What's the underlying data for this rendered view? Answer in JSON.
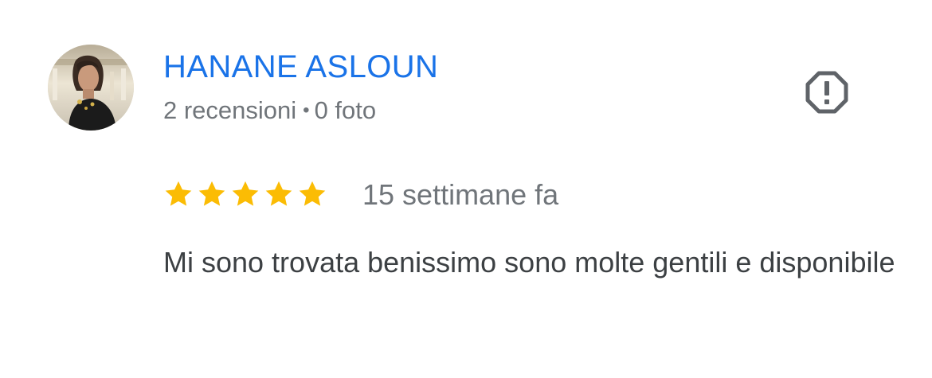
{
  "review": {
    "author": {
      "name": "HANANE ASLOUN",
      "reviews_count": "2 recensioni",
      "separator": "•",
      "photos_count": "0 foto",
      "avatar": "avatar-photo"
    },
    "report_icon": "report-octagon-icon",
    "rating": {
      "stars": 5,
      "max_stars": 5,
      "star_icon": "star-icon",
      "star_color": "#fbbc04"
    },
    "time": "15 settimane fa",
    "text": "Mi sono trovata benissimo sono molte gentili e disponibile"
  },
  "colors": {
    "author_name": "#1a73e8",
    "meta_text": "#70757a",
    "body_text": "#3c4043",
    "icon": "#5f6368",
    "background": "#ffffff"
  }
}
